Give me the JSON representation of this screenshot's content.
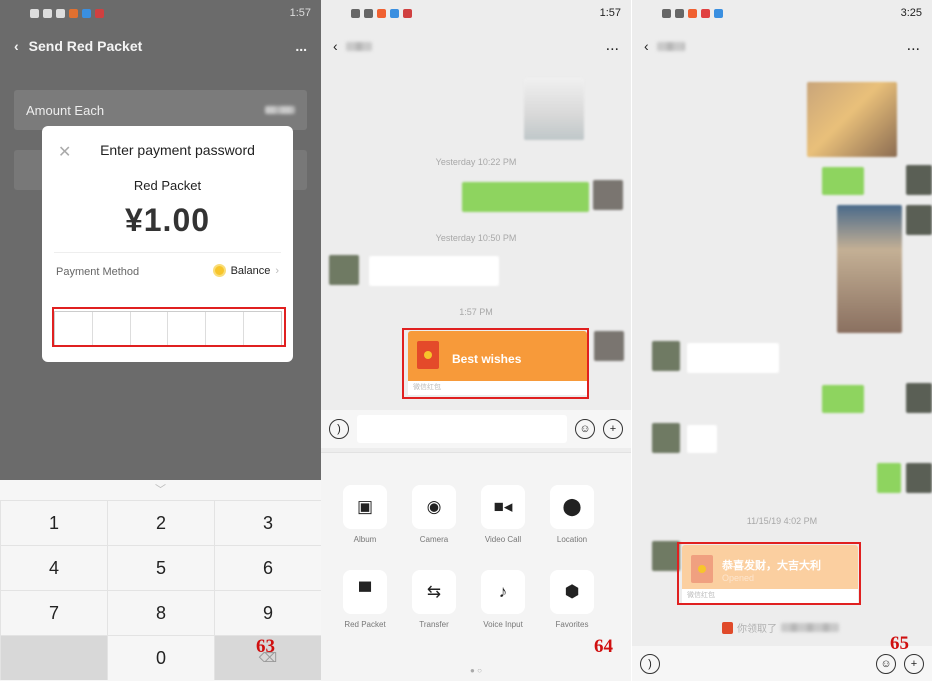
{
  "panel1": {
    "status_time": "1:57",
    "title": "Send Red Packet",
    "more": "...",
    "amount_label": "Amount Each",
    "dialog": {
      "close_icon": "✕",
      "title": "Enter payment password",
      "subtitle": "Red Packet",
      "amount": "¥1.00",
      "payment_label": "Payment Method",
      "payment_value": "Balance",
      "payment_chevron": "›"
    },
    "keys": [
      "1",
      "2",
      "3",
      "4",
      "5",
      "6",
      "7",
      "8",
      "9",
      "",
      "0",
      "⌫"
    ],
    "step_number": "63"
  },
  "panel2": {
    "status_time": "1:57",
    "back": "‹",
    "more": "...",
    "timestamps": [
      "Yesterday 10:22 PM",
      "Yesterday 10:50 PM",
      "1:57 PM"
    ],
    "red_packet_text": "Best wishes",
    "red_packet_footer": "微信红包",
    "voice_icon": "voice-icon",
    "emoji_icon": "emoji-icon",
    "plus_icon": "plus-icon",
    "tools": [
      {
        "label": "Album",
        "icon": "album-icon"
      },
      {
        "label": "Camera",
        "icon": "camera-icon"
      },
      {
        "label": "Video Call",
        "icon": "video-call-icon"
      },
      {
        "label": "Location",
        "icon": "location-icon"
      },
      {
        "label": "Red Packet",
        "icon": "red-packet-icon"
      },
      {
        "label": "Transfer",
        "icon": "transfer-icon"
      },
      {
        "label": "Voice Input",
        "icon": "voice-input-icon"
      },
      {
        "label": "Favorites",
        "icon": "favorites-icon"
      }
    ],
    "step_number": "64"
  },
  "panel3": {
    "status_time": "3:25",
    "back": "‹",
    "more": "...",
    "timestamp": "11/15/19 4:02 PM",
    "red_packet_text": "恭喜发财，大吉大利",
    "red_packet_status": "Opened",
    "red_packet_footer": "微信红包",
    "claim_notice": "你领取了",
    "step_number": "65"
  },
  "colors": {
    "red_packet": "#f79a3a",
    "highlight": "#e02020",
    "bubble_green": "#95ec69",
    "step_red": "#d01010"
  }
}
